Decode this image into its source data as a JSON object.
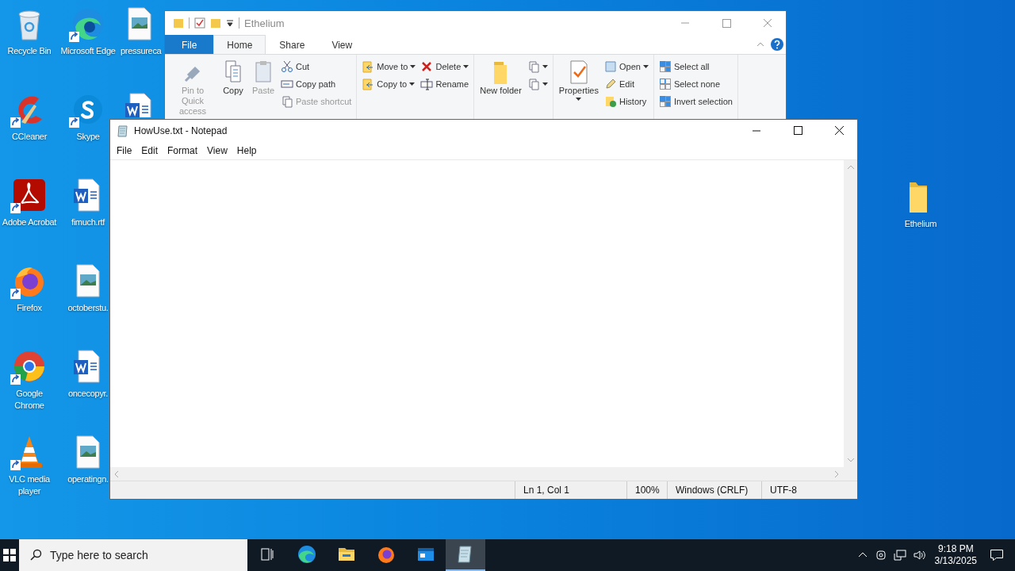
{
  "desktop": {
    "columns": [
      [
        {
          "label": "Recycle Bin",
          "kind": "recycle",
          "shortcut": false
        },
        {
          "label": "CCleaner",
          "kind": "ccleaner",
          "shortcut": true
        },
        {
          "label": "Adobe Acrobat",
          "kind": "acrobat",
          "shortcut": true
        },
        {
          "label": "Firefox",
          "kind": "firefox",
          "shortcut": true
        },
        {
          "label": "Google Chrome",
          "kind": "chrome",
          "shortcut": true
        },
        {
          "label": "VLC media player",
          "kind": "vlc",
          "shortcut": true
        }
      ],
      [
        {
          "label": "Microsoft Edge",
          "kind": "edge",
          "shortcut": true
        },
        {
          "label": "Skype",
          "kind": "skype",
          "shortcut": true
        },
        {
          "label": "fimuch.rtf",
          "kind": "word",
          "shortcut": false
        },
        {
          "label": "octoberstu.",
          "kind": "image",
          "shortcut": false
        },
        {
          "label": "oncecopyr.",
          "kind": "word",
          "shortcut": false
        },
        {
          "label": "operatingn.",
          "kind": "image",
          "shortcut": false
        }
      ],
      [
        {
          "label": "pressureca",
          "kind": "image",
          "shortcut": false
        },
        {
          "kind": "word"
        }
      ]
    ],
    "right_icon": {
      "label": "Ethelium",
      "shortcut": false
    }
  },
  "explorer": {
    "title": "Ethelium",
    "tabs": [
      {
        "label": "File",
        "kind": "file",
        "selected": false
      },
      {
        "label": "Home",
        "kind": "tab",
        "selected": true
      },
      {
        "label": "Share",
        "kind": "tab",
        "selected": false
      },
      {
        "label": "View",
        "kind": "tab",
        "selected": false
      }
    ],
    "groups": [
      {
        "buttons": [
          {
            "label": "Pin to Quick access",
            "kind": "pin",
            "disabled": true,
            "dropdown": false
          },
          {
            "label": "Copy",
            "kind": "copy",
            "disabled": false,
            "dropdown": false
          },
          {
            "label": "Paste",
            "kind": "paste",
            "disabled": true,
            "dropdown": false
          }
        ],
        "stacks": [
          [
            {
              "label": "Cut",
              "kind": "cut",
              "disabled": false,
              "dropdown": false
            },
            {
              "label": "Copy path",
              "kind": "path",
              "disabled": false,
              "dropdown": false
            },
            {
              "label": "Paste shortcut",
              "kind": "paste",
              "disabled": true,
              "dropdown": false
            }
          ]
        ]
      },
      {
        "stacks": [
          [
            {
              "label": "Move to",
              "kind": "move",
              "disabled": false,
              "dropdown": true
            },
            {
              "label": "Copy to",
              "kind": "move",
              "disabled": false,
              "dropdown": true
            }
          ],
          [
            {
              "label": "Delete",
              "kind": "delete",
              "disabled": false,
              "dropdown": true
            },
            {
              "label": "Rename",
              "kind": "rename",
              "disabled": false,
              "dropdown": false
            }
          ]
        ]
      },
      {
        "buttons": [
          {
            "label": "New folder",
            "kind": "folder",
            "disabled": false,
            "dropdown": false
          }
        ],
        "stacks": [
          [
            {
              "kind": "copy",
              "dropdown": true
            },
            {
              "kind": "newitem",
              "dropdown": true
            }
          ]
        ]
      },
      {
        "buttons": [
          {
            "label": "Properties",
            "kind": "properties",
            "disabled": false,
            "dropdown": true
          }
        ],
        "stacks": [
          [
            {
              "label": "Open",
              "kind": "open",
              "disabled": false,
              "dropdown": true
            },
            {
              "label": "Edit",
              "kind": "edit",
              "disabled": false,
              "dropdown": false
            },
            {
              "label": "History",
              "kind": "history",
              "disabled": false,
              "dropdown": false
            }
          ]
        ]
      },
      {
        "stacks": [
          [
            {
              "label": "Select all",
              "kind": "grid",
              "disabled": false,
              "dropdown": false
            },
            {
              "label": "Select none",
              "kind": "gridempty",
              "disabled": false,
              "dropdown": false
            },
            {
              "label": "Invert selection",
              "kind": "grid",
              "disabled": false,
              "dropdown": false
            }
          ]
        ]
      }
    ]
  },
  "notepad": {
    "title": "HowUse.txt - Notepad",
    "menu": [
      "File",
      "Edit",
      "Format",
      "View",
      "Help"
    ],
    "status_bar": [
      "Ln 1, Col 1",
      "100%",
      "Windows (CRLF)",
      "UTF-8"
    ]
  },
  "taskbar": {
    "search": {
      "placeholder": "Type here to search"
    },
    "apps": [
      {
        "kind": "taskview",
        "selected": false
      },
      {
        "kind": "edge",
        "selected": false
      },
      {
        "kind": "explorer",
        "selected": false
      },
      {
        "kind": "firefox",
        "selected": false
      },
      {
        "kind": "window",
        "selected": false
      },
      {
        "kind": "notepad",
        "selected": true
      }
    ],
    "time": "9:18 PM",
    "date": "3/13/2025"
  }
}
